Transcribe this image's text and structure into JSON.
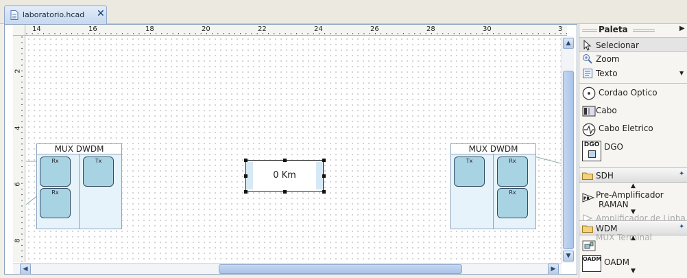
{
  "tab": {
    "title": "laboratorio.hcad",
    "close": "✕"
  },
  "ruler": {
    "top_labels": [
      "14",
      "16",
      "18",
      "20",
      "22",
      "24",
      "26",
      "28",
      "30",
      "3"
    ],
    "left_labels": [
      "2",
      "4",
      "6",
      "8"
    ]
  },
  "canvas": {
    "mux_left": {
      "title": "MUX DWDM",
      "ports": [
        "Rx",
        "Tx",
        "Rx"
      ]
    },
    "mux_right": {
      "title": "MUX DWDM",
      "ports": [
        "Tx",
        "Rx",
        "Rx"
      ]
    },
    "fiber": {
      "label": "0 Km"
    }
  },
  "palette": {
    "title": "Paleta",
    "items": [
      {
        "label": "Selecionar",
        "icon": "cursor-arrow-icon"
      },
      {
        "label": "Zoom",
        "icon": "zoom-icon"
      },
      {
        "label": "Texto",
        "icon": "text-icon"
      },
      {
        "label": "Cordao Optico",
        "icon": "optical-cord-icon"
      },
      {
        "label": "Cabo",
        "icon": "cable-icon"
      },
      {
        "label": "Cabo Eletrico",
        "icon": "electric-cable-icon"
      },
      {
        "label": "DGO",
        "icon": "dgo-icon"
      }
    ],
    "drawers": [
      {
        "label": "SDH"
      },
      {
        "label": "WDM"
      }
    ],
    "sdh_items": [
      {
        "label_line1": "Pre-Amplificador",
        "label_line2": "RAMAN"
      },
      {
        "label": "Amplificador de Linha"
      }
    ],
    "wdm_items": [
      {
        "label": "MUX Terminal"
      },
      {
        "label": "OADM"
      }
    ]
  }
}
